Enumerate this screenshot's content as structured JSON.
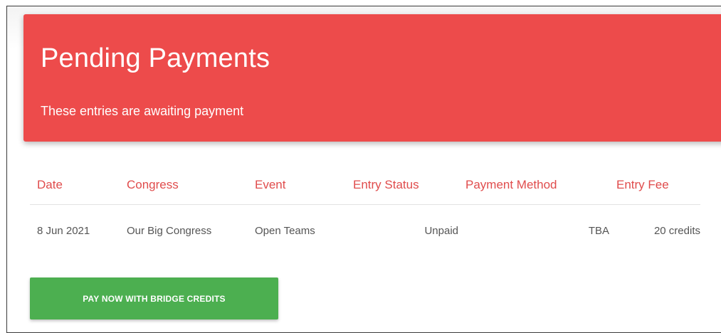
{
  "header": {
    "title": "Pending Payments",
    "subtitle": "These entries are awaiting payment",
    "background_color": "#ed4b4b"
  },
  "table": {
    "columns": [
      "Date",
      "Congress",
      "Event",
      "Entry Status",
      "Payment Method",
      "Entry Fee"
    ],
    "rows": [
      {
        "date": "8 Jun 2021",
        "congress": "Our Big Congress",
        "event": "Open Teams",
        "entry_status": "Unpaid",
        "payment_method": "TBA",
        "entry_fee": "20 credits"
      }
    ],
    "header_color": "#e04c4c",
    "link_color": "#8e3ec1"
  },
  "actions": {
    "pay_label": "PAY NOW WITH BRIDGE CREDITS",
    "pay_color": "#4caf50"
  }
}
